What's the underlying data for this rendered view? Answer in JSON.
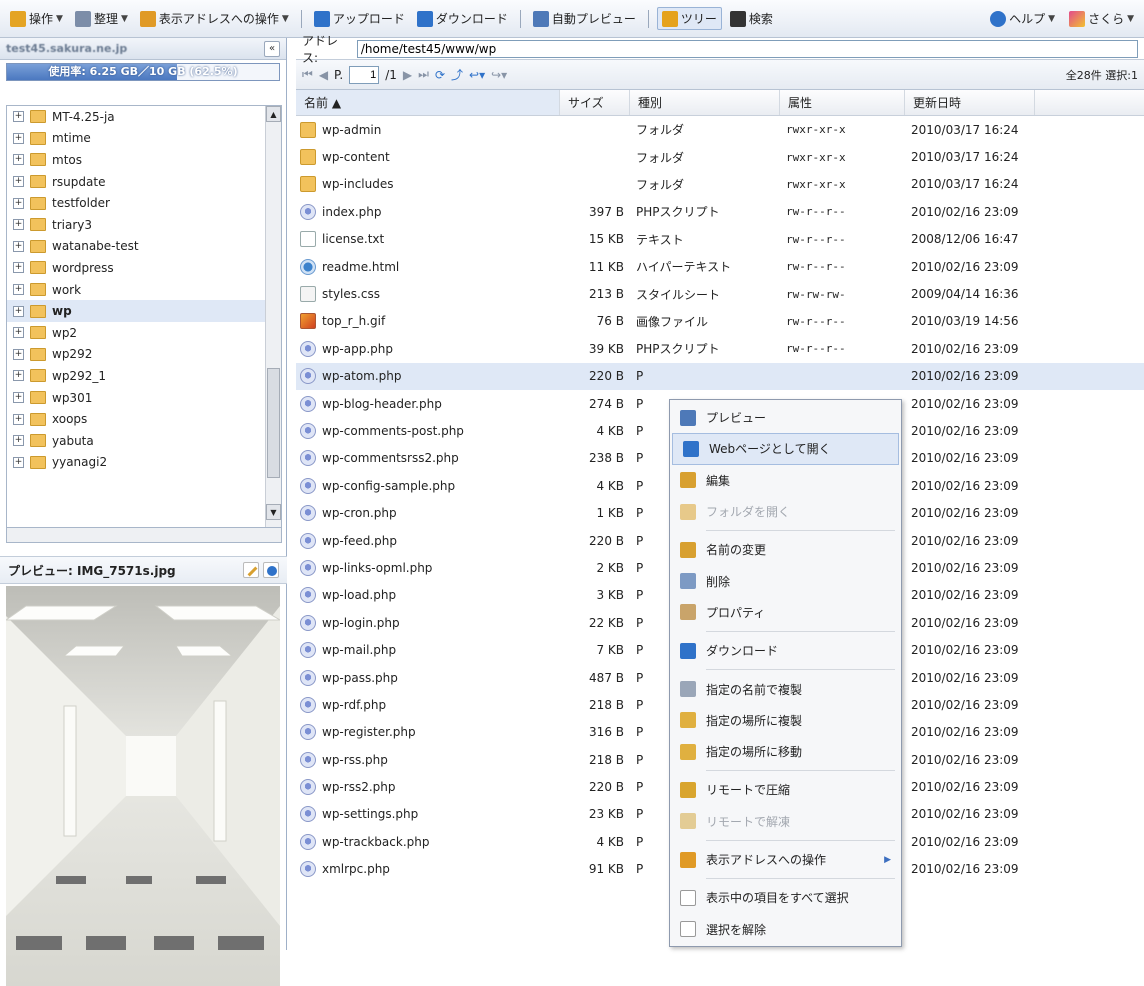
{
  "toolbar": {
    "items": [
      {
        "label": "操作",
        "dropdown": true,
        "icon": "hand-icon",
        "color": "#e4a424"
      },
      {
        "label": "整理",
        "dropdown": true,
        "icon": "document-icon",
        "color": "#7c8da8"
      },
      {
        "label": "表示アドレスへの操作",
        "dropdown": true,
        "icon": "folder-arrow-icon",
        "color": "#e09a26"
      },
      {
        "label": "アップロード",
        "dropdown": false,
        "icon": "upload-icon",
        "color": "#2f72c9"
      },
      {
        "label": "ダウンロード",
        "dropdown": false,
        "icon": "download-icon",
        "color": "#2f72c9"
      },
      {
        "label": "自動プレビュー",
        "dropdown": false,
        "icon": "monitor-icon",
        "color": "#4e79b8"
      },
      {
        "label": "ツリー",
        "dropdown": false,
        "icon": "tree-icon",
        "color": "#e5a21c",
        "active": true
      },
      {
        "label": "検索",
        "dropdown": false,
        "icon": "binoculars-icon",
        "color": "#333333"
      }
    ],
    "help_label": "ヘルプ",
    "sakura_label": "さくら"
  },
  "account": {
    "host": "test45.sakura.ne.jp",
    "collapse_label": "«"
  },
  "usage": {
    "label": "使用率: 6.25 GB／10 GB (62.5%)",
    "fraction": 0.625
  },
  "tree": {
    "items": [
      {
        "name": "MT-4.25-ja"
      },
      {
        "name": "mtime"
      },
      {
        "name": "mtos"
      },
      {
        "name": "rsupdate"
      },
      {
        "name": "testfolder"
      },
      {
        "name": "triary3"
      },
      {
        "name": "watanabe-test"
      },
      {
        "name": "wordpress"
      },
      {
        "name": "work"
      },
      {
        "name": "wp",
        "selected": true
      },
      {
        "name": "wp2"
      },
      {
        "name": "wp292"
      },
      {
        "name": "wp292_1"
      },
      {
        "name": "wp301"
      },
      {
        "name": "xoops"
      },
      {
        "name": "yabuta"
      },
      {
        "name": "yyanagi2"
      }
    ]
  },
  "preview": {
    "title": "プレビュー: IMG_7571s.jpg"
  },
  "address": {
    "label": "アドレス:",
    "value": "/home/test45/www/wp"
  },
  "pager": {
    "page_prefix": "P.",
    "page": "1",
    "total": "/1",
    "count": "全28件 選択:1"
  },
  "table": {
    "columns": [
      "名前 ▲",
      "サイズ",
      "種別",
      "属性",
      "更新日時"
    ],
    "rows": [
      {
        "name": "wp-admin",
        "size": "",
        "type": "フォルダ",
        "attr": "rwxr-xr-x",
        "date": "2010/03/17 16:24",
        "icon": "folder"
      },
      {
        "name": "wp-content",
        "size": "",
        "type": "フォルダ",
        "attr": "rwxr-xr-x",
        "date": "2010/03/17 16:24",
        "icon": "folder"
      },
      {
        "name": "wp-includes",
        "size": "",
        "type": "フォルダ",
        "attr": "rwxr-xr-x",
        "date": "2010/03/17 16:24",
        "icon": "folder"
      },
      {
        "name": "index.php",
        "size": "397 B",
        "type": "PHPスクリプト",
        "attr": "rw-r--r--",
        "date": "2010/02/16 23:09",
        "icon": "php"
      },
      {
        "name": "license.txt",
        "size": "15 KB",
        "type": "テキスト",
        "attr": "rw-r--r--",
        "date": "2008/12/06 16:47",
        "icon": "txt"
      },
      {
        "name": "readme.html",
        "size": "11 KB",
        "type": "ハイパーテキスト",
        "attr": "rw-r--r--",
        "date": "2010/02/16 23:09",
        "icon": "html"
      },
      {
        "name": "styles.css",
        "size": "213 B",
        "type": "スタイルシート",
        "attr": "rw-rw-rw-",
        "date": "2009/04/14 16:36",
        "icon": "css"
      },
      {
        "name": "top_r_h.gif",
        "size": "76 B",
        "type": "画像ファイル",
        "attr": "rw-r--r--",
        "date": "2010/03/19 14:56",
        "icon": "gif"
      },
      {
        "name": "wp-app.php",
        "size": "39 KB",
        "type": "PHPスクリプト",
        "attr": "rw-r--r--",
        "date": "2010/02/16 23:09",
        "icon": "php"
      },
      {
        "name": "wp-atom.php",
        "size": "220 B",
        "type": "P",
        "attr": "",
        "date": "2010/02/16 23:09",
        "icon": "php",
        "selected": true
      },
      {
        "name": "wp-blog-header.php",
        "size": "274 B",
        "type": "P",
        "attr": "",
        "date": "2010/02/16 23:09",
        "icon": "php"
      },
      {
        "name": "wp-comments-post.php",
        "size": "4 KB",
        "type": "P",
        "attr": "",
        "date": "2010/02/16 23:09",
        "icon": "php"
      },
      {
        "name": "wp-commentsrss2.php",
        "size": "238 B",
        "type": "P",
        "attr": "",
        "date": "2010/02/16 23:09",
        "icon": "php"
      },
      {
        "name": "wp-config-sample.php",
        "size": "4 KB",
        "type": "P",
        "attr": "",
        "date": "2010/02/16 23:09",
        "icon": "php"
      },
      {
        "name": "wp-cron.php",
        "size": "1 KB",
        "type": "P",
        "attr": "",
        "date": "2010/02/16 23:09",
        "icon": "php"
      },
      {
        "name": "wp-feed.php",
        "size": "220 B",
        "type": "P",
        "attr": "",
        "date": "2010/02/16 23:09",
        "icon": "php"
      },
      {
        "name": "wp-links-opml.php",
        "size": "2 KB",
        "type": "P",
        "attr": "",
        "date": "2010/02/16 23:09",
        "icon": "php"
      },
      {
        "name": "wp-load.php",
        "size": "3 KB",
        "type": "P",
        "attr": "",
        "date": "2010/02/16 23:09",
        "icon": "php"
      },
      {
        "name": "wp-login.php",
        "size": "22 KB",
        "type": "P",
        "attr": "",
        "date": "2010/02/16 23:09",
        "icon": "php"
      },
      {
        "name": "wp-mail.php",
        "size": "7 KB",
        "type": "P",
        "attr": "",
        "date": "2010/02/16 23:09",
        "icon": "php"
      },
      {
        "name": "wp-pass.php",
        "size": "487 B",
        "type": "P",
        "attr": "",
        "date": "2010/02/16 23:09",
        "icon": "php"
      },
      {
        "name": "wp-rdf.php",
        "size": "218 B",
        "type": "P",
        "attr": "",
        "date": "2010/02/16 23:09",
        "icon": "php"
      },
      {
        "name": "wp-register.php",
        "size": "316 B",
        "type": "P",
        "attr": "",
        "date": "2010/02/16 23:09",
        "icon": "php"
      },
      {
        "name": "wp-rss.php",
        "size": "218 B",
        "type": "P",
        "attr": "",
        "date": "2010/02/16 23:09",
        "icon": "php"
      },
      {
        "name": "wp-rss2.php",
        "size": "220 B",
        "type": "P",
        "attr": "",
        "date": "2010/02/16 23:09",
        "icon": "php"
      },
      {
        "name": "wp-settings.php",
        "size": "23 KB",
        "type": "P",
        "attr": "",
        "date": "2010/02/16 23:09",
        "icon": "php"
      },
      {
        "name": "wp-trackback.php",
        "size": "4 KB",
        "type": "P",
        "attr": "",
        "date": "2010/02/16 23:09",
        "icon": "php"
      },
      {
        "name": "xmlrpc.php",
        "size": "91 KB",
        "type": "P",
        "attr": "",
        "date": "2010/02/16 23:09",
        "icon": "php"
      }
    ]
  },
  "context_menu": {
    "items": [
      {
        "label": "プレビュー",
        "icon": "monitor-icon",
        "color": "#4e79b8"
      },
      {
        "label": "Webページとして開く",
        "icon": "globe-icon",
        "color": "#2f72c9",
        "highlight": true
      },
      {
        "label": "編集",
        "icon": "pencil-icon",
        "color": "#d8a030"
      },
      {
        "label": "フォルダを開く",
        "icon": "folder-open-icon",
        "color": "#e7c98a",
        "disabled": true
      },
      {
        "sep": true
      },
      {
        "label": "名前の変更",
        "icon": "rename-pencil-icon",
        "color": "#d8a030"
      },
      {
        "label": "削除",
        "icon": "delete-icon",
        "color": "#7d9ac4"
      },
      {
        "label": "プロパティ",
        "icon": "properties-icon",
        "color": "#c9a46a"
      },
      {
        "sep": true
      },
      {
        "label": "ダウンロード",
        "icon": "download-icon",
        "color": "#2f72c9"
      },
      {
        "sep": true
      },
      {
        "label": "指定の名前で複製",
        "icon": "copy-icon",
        "color": "#9aa6b8"
      },
      {
        "label": "指定の場所に複製",
        "icon": "copy-to-folder-icon",
        "color": "#e0b040"
      },
      {
        "label": "指定の場所に移動",
        "icon": "move-to-folder-icon",
        "color": "#e0b040"
      },
      {
        "sep": true
      },
      {
        "label": "リモートで圧縮",
        "icon": "compress-icon",
        "color": "#d9a52e"
      },
      {
        "label": "リモートで解凍",
        "icon": "extract-icon",
        "color": "#e3cc95",
        "disabled": true
      },
      {
        "sep": true
      },
      {
        "label": "表示アドレスへの操作",
        "icon": "folder-arrow-icon",
        "color": "#e09a26",
        "submenu": true
      },
      {
        "sep": true
      },
      {
        "label": "表示中の項目をすべて選択",
        "icon": "select-all-icon",
        "color": "#ffffff"
      },
      {
        "label": "選択を解除",
        "icon": "deselect-icon",
        "color": "#ffffff"
      }
    ]
  }
}
